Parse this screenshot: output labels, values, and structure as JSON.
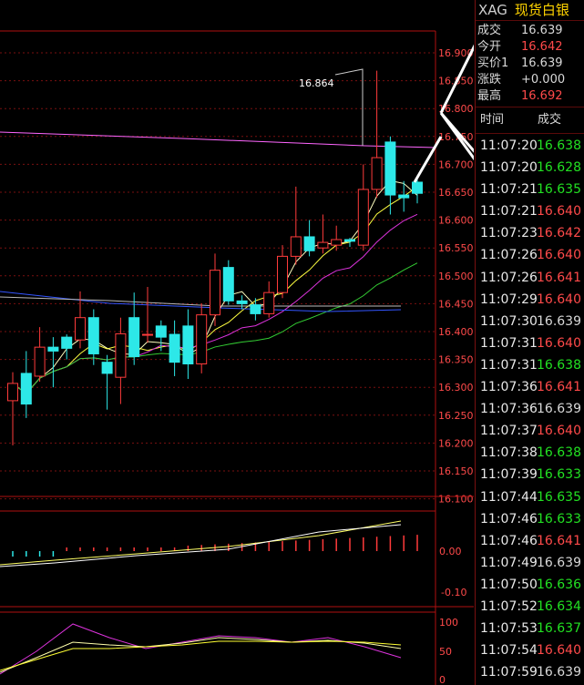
{
  "header": {
    "symbol": "XAG",
    "name": "现货白银"
  },
  "quote": [
    {
      "label": "成交",
      "value": "16.639",
      "color": "#d8d8d8"
    },
    {
      "label": "今开",
      "value": "16.642",
      "color": "#ff4a4a"
    },
    {
      "label": "买价1",
      "value": "16.639",
      "color": "#d8d8d8"
    },
    {
      "label": "涨跌",
      "value": "+0.000",
      "color": "#d8d8d8"
    },
    {
      "label": "最高",
      "value": "16.692",
      "color": "#ff4a4a"
    }
  ],
  "trades_header": {
    "time": "时间",
    "price": "成交"
  },
  "trades": [
    {
      "time": "11:07:20",
      "price": "16.638",
      "color": "#22e022"
    },
    {
      "time": "11:07:20",
      "price": "16.628",
      "color": "#22e022"
    },
    {
      "time": "11:07:21",
      "price": "16.635",
      "color": "#22e022"
    },
    {
      "time": "11:07:21",
      "price": "16.640",
      "color": "#ff4a4a"
    },
    {
      "time": "11:07:23",
      "price": "16.642",
      "color": "#ff4a4a"
    },
    {
      "time": "11:07:26",
      "price": "16.640",
      "color": "#ff4a4a"
    },
    {
      "time": "11:07:26",
      "price": "16.641",
      "color": "#ff4a4a"
    },
    {
      "time": "11:07:29",
      "price": "16.640",
      "color": "#ff4a4a"
    },
    {
      "time": "11:07:30",
      "price": "16.639",
      "color": "#d8d8d8"
    },
    {
      "time": "11:07:31",
      "price": "16.640",
      "color": "#ff4a4a"
    },
    {
      "time": "11:07:31",
      "price": "16.638",
      "color": "#22e022"
    },
    {
      "time": "11:07:36",
      "price": "16.641",
      "color": "#ff4a4a"
    },
    {
      "time": "11:07:36",
      "price": "16.639",
      "color": "#d8d8d8"
    },
    {
      "time": "11:07:37",
      "price": "16.640",
      "color": "#ff4a4a"
    },
    {
      "time": "11:07:38",
      "price": "16.638",
      "color": "#22e022"
    },
    {
      "time": "11:07:39",
      "price": "16.633",
      "color": "#22e022"
    },
    {
      "time": "11:07:44",
      "price": "16.635",
      "color": "#22e022"
    },
    {
      "time": "11:07:46",
      "price": "16.633",
      "color": "#22e022"
    },
    {
      "time": "11:07:46",
      "price": "16.641",
      "color": "#ff4a4a"
    },
    {
      "time": "11:07:49",
      "price": "16.639",
      "color": "#d8d8d8"
    },
    {
      "time": "11:07:50",
      "price": "16.636",
      "color": "#22e022"
    },
    {
      "time": "11:07:52",
      "price": "16.634",
      "color": "#22e022"
    },
    {
      "time": "11:07:53",
      "price": "16.637",
      "color": "#22e022"
    },
    {
      "time": "11:07:54",
      "price": "16.640",
      "color": "#ff4a4a"
    },
    {
      "time": "11:07:59",
      "price": "16.639",
      "color": "#d8d8d8"
    }
  ],
  "main_chart": {
    "price_ticks": [
      "16.900",
      "16.850",
      "16.800",
      "16.750",
      "16.700",
      "16.650",
      "16.600",
      "16.550",
      "16.500",
      "16.450",
      "16.400",
      "16.350",
      "16.300",
      "16.250",
      "16.200",
      "16.150",
      "16.100"
    ],
    "high_marker": "16.864",
    "candles": [
      {
        "o": 16.276,
        "c": 16.307,
        "h": 16.327,
        "l": 16.196
      },
      {
        "o": 16.325,
        "c": 16.27,
        "h": 16.365,
        "l": 16.245
      },
      {
        "o": 16.32,
        "c": 16.372,
        "h": 16.408,
        "l": 16.31
      },
      {
        "o": 16.372,
        "c": 16.365,
        "h": 16.39,
        "l": 16.3
      },
      {
        "o": 16.39,
        "c": 16.37,
        "h": 16.395,
        "l": 16.35
      },
      {
        "o": 16.385,
        "c": 16.425,
        "h": 16.472,
        "l": 16.37
      },
      {
        "o": 16.425,
        "c": 16.36,
        "h": 16.44,
        "l": 16.34
      },
      {
        "o": 16.345,
        "c": 16.325,
        "h": 16.358,
        "l": 16.26
      },
      {
        "o": 16.318,
        "c": 16.396,
        "h": 16.425,
        "l": 16.27
      },
      {
        "o": 16.425,
        "c": 16.355,
        "h": 16.47,
        "l": 16.34
      },
      {
        "o": 16.395,
        "c": 16.395,
        "h": 16.48,
        "l": 16.38
      },
      {
        "o": 16.41,
        "c": 16.39,
        "h": 16.42,
        "l": 16.365
      },
      {
        "o": 16.395,
        "c": 16.345,
        "h": 16.42,
        "l": 16.32
      },
      {
        "o": 16.41,
        "c": 16.342,
        "h": 16.44,
        "l": 16.315
      },
      {
        "o": 16.342,
        "c": 16.43,
        "h": 16.45,
        "l": 16.325
      },
      {
        "o": 16.43,
        "c": 16.51,
        "h": 16.54,
        "l": 16.41
      },
      {
        "o": 16.515,
        "c": 16.455,
        "h": 16.528,
        "l": 16.448
      },
      {
        "o": 16.455,
        "c": 16.45,
        "h": 16.465,
        "l": 16.44
      },
      {
        "o": 16.448,
        "c": 16.432,
        "h": 16.46,
        "l": 16.42
      },
      {
        "o": 16.432,
        "c": 16.47,
        "h": 16.49,
        "l": 16.425
      },
      {
        "o": 16.47,
        "c": 16.535,
        "h": 16.555,
        "l": 16.46
      },
      {
        "o": 16.535,
        "c": 16.57,
        "h": 16.66,
        "l": 16.52
      },
      {
        "o": 16.57,
        "c": 16.545,
        "h": 16.6,
        "l": 16.535
      },
      {
        "o": 16.55,
        "c": 16.56,
        "h": 16.61,
        "l": 16.54
      },
      {
        "o": 16.555,
        "c": 16.565,
        "h": 16.59,
        "l": 16.545
      },
      {
        "o": 16.565,
        "c": 16.562,
        "h": 16.568,
        "l": 16.552
      },
      {
        "o": 16.555,
        "c": 16.655,
        "h": 16.7,
        "l": 16.545
      },
      {
        "o": 16.655,
        "c": 16.712,
        "h": 16.868,
        "l": 16.64
      },
      {
        "o": 16.74,
        "c": 16.645,
        "h": 16.75,
        "l": 16.61
      },
      {
        "o": 16.645,
        "c": 16.64,
        "h": 16.67,
        "l": 16.615
      },
      {
        "o": 16.668,
        "c": 16.648,
        "h": 16.675,
        "l": 16.63
      }
    ],
    "color_up": "#ff3b3b",
    "color_down": "#2de8e8",
    "ma_colors": [
      "#ffffc0",
      "#ffff40",
      "#dd33dd",
      "#33cc33",
      "#3355ff",
      "#bbbbbb",
      "#ff66ff"
    ]
  },
  "macd_panel": {
    "tick_top": "0.00",
    "tick_bottom": "-0.10"
  },
  "kdj_panel": {
    "ticks": [
      "100",
      "50",
      "0"
    ]
  }
}
